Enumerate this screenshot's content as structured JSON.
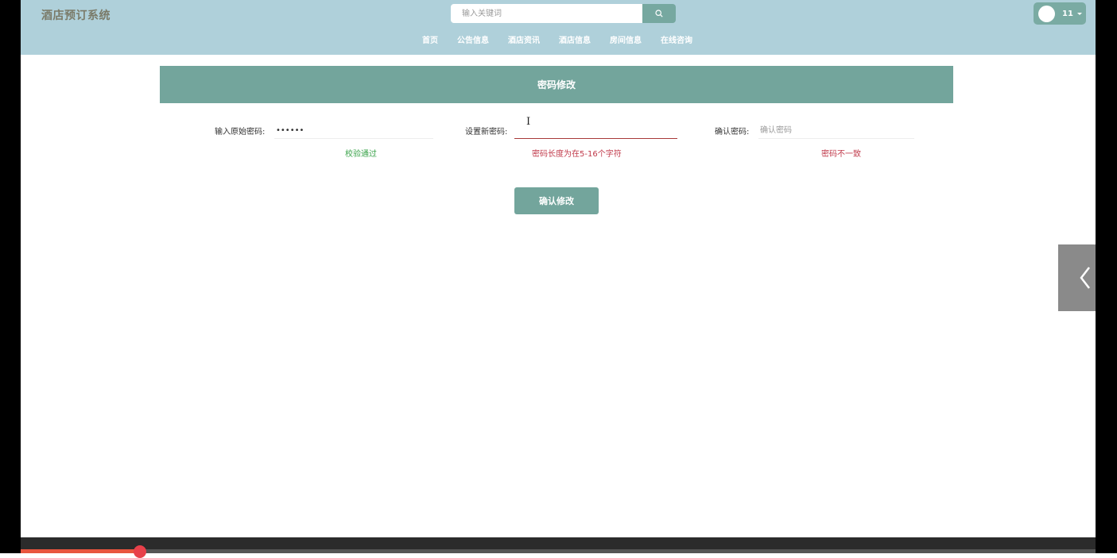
{
  "header": {
    "logo": "酒店预订系统",
    "search": {
      "placeholder": "输入关键词",
      "value": ""
    },
    "nav": [
      "首页",
      "公告信息",
      "酒店资讯",
      "酒店信息",
      "房间信息",
      "在线咨询"
    ],
    "user": {
      "name": "11"
    }
  },
  "main": {
    "banner_title": "密码修改",
    "fields": [
      {
        "label": "输入原始密码:",
        "value": "••••••",
        "placeholder": "",
        "hint": "校验通过",
        "hint_status": "ok"
      },
      {
        "label": "设置新密码:",
        "value": "",
        "placeholder": "",
        "hint": "密码长度为在5-16个字符",
        "hint_status": "error"
      },
      {
        "label": "确认密码:",
        "value": "",
        "placeholder": "确认密码",
        "hint": "密码不一致",
        "hint_status": "error"
      }
    ],
    "confirm_label": "确认修改"
  },
  "video_progress": 0.111,
  "colors": {
    "header_bg": "#afd0da",
    "accent": "#73a59c",
    "ok": "#3aa34a",
    "error": "#c0394a"
  },
  "icons": {
    "search": "search-icon",
    "side_tab": "chevron-left-icon"
  }
}
